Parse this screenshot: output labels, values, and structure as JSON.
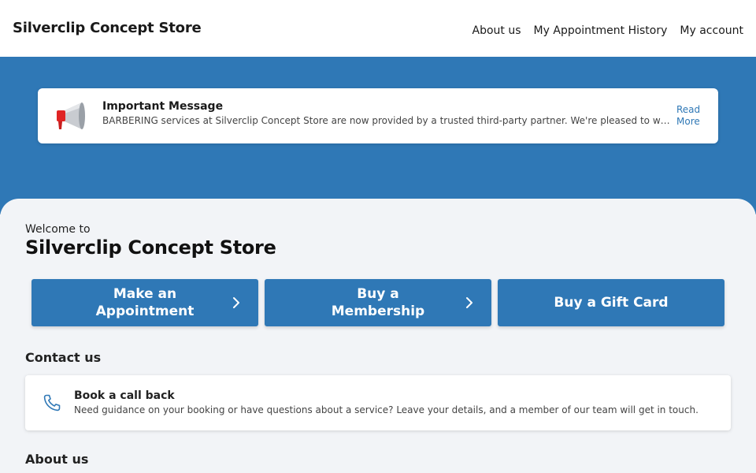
{
  "header": {
    "brand": "Silverclip Concept Store",
    "nav": [
      "About us",
      "My Appointment History",
      "My account"
    ]
  },
  "message": {
    "icon": "megaphone-icon",
    "title": "Important Message",
    "text": "BARBERING services at Silverclip Concept Store are now provided by a trusted third-party partner. We're pleased to welcome",
    "read_more": "Read More"
  },
  "welcome": {
    "intro": "Welcome to",
    "title": "Silverclip Concept Store"
  },
  "actions": [
    {
      "label": "Make an Appointment",
      "icon": "chevron-right-icon"
    },
    {
      "label": "Buy a Membership",
      "icon": "chevron-right-icon"
    },
    {
      "label": "Buy a Gift Card"
    }
  ],
  "contact": {
    "heading": "Contact us",
    "callback_title": "Book a call back",
    "callback_text": "Need guidance on your booking or have questions about a service? Leave your details, and a member of our team will get in touch.",
    "icon": "phone-icon"
  },
  "about": {
    "heading": "About us"
  },
  "colors": {
    "accent": "#2f78b6",
    "background": "#f2f4f7",
    "card": "#ffffff"
  }
}
